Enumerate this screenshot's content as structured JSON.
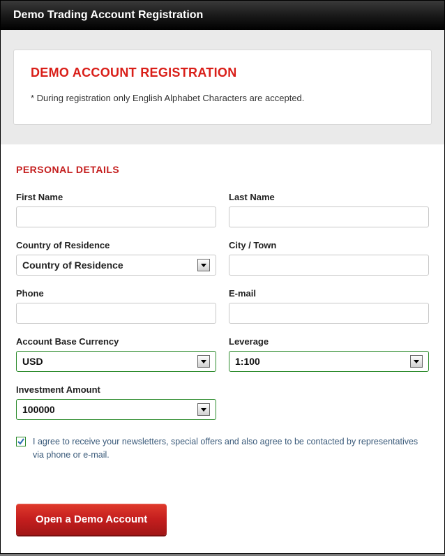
{
  "header": {
    "title": "Demo Trading Account Registration"
  },
  "info": {
    "title": "DEMO ACCOUNT REGISTRATION",
    "note": "* During registration only English Alphabet Characters are accepted."
  },
  "section_title": "PERSONAL DETAILS",
  "fields": {
    "first_name": {
      "label": "First Name",
      "value": ""
    },
    "last_name": {
      "label": "Last Name",
      "value": ""
    },
    "country": {
      "label": "Country of Residence",
      "value": "Country of Residence"
    },
    "city": {
      "label": "City / Town",
      "value": ""
    },
    "phone": {
      "label": "Phone",
      "value": ""
    },
    "email": {
      "label": "E-mail",
      "value": ""
    },
    "currency": {
      "label": "Account Base Currency",
      "value": "USD"
    },
    "leverage": {
      "label": "Leverage",
      "value": "1:100"
    },
    "investment": {
      "label": "Investment Amount",
      "value": "100000"
    }
  },
  "consent": {
    "checked": true,
    "text": "I agree to receive your newsletters, special offers and also agree to be contacted by representatives via phone or e-mail."
  },
  "submit": {
    "label": "Open a Demo Account"
  }
}
